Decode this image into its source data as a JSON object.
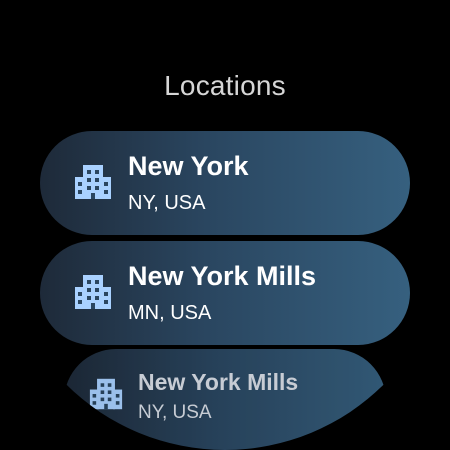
{
  "screen": {
    "title": "Locations"
  },
  "locations": [
    {
      "name": "New York",
      "region": "NY, USA",
      "icon": "city-buildings-icon"
    },
    {
      "name": "New York Mills",
      "region": "MN, USA",
      "icon": "city-buildings-icon"
    },
    {
      "name": "New York Mills",
      "region": "NY, USA",
      "icon": "city-buildings-icon"
    }
  ],
  "colors": {
    "background": "#000000",
    "title_text": "#d6d6d6",
    "chip_gradient_start": "#1e2a39",
    "chip_gradient_end": "#36607f",
    "icon_color": "#a9d1ff",
    "chip_text": "#ffffff"
  }
}
